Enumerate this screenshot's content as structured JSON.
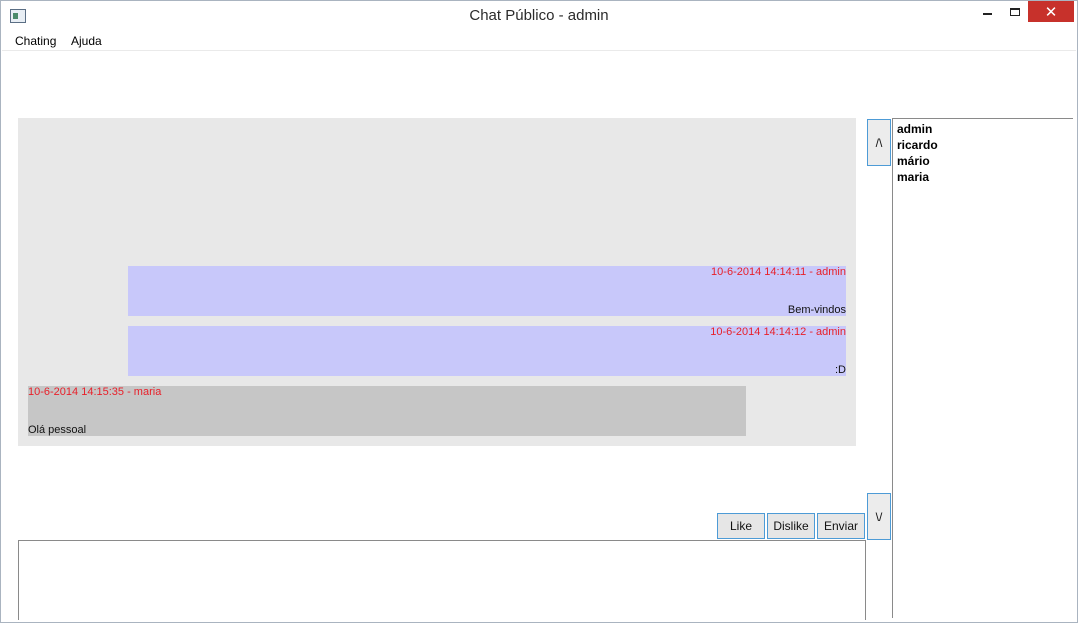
{
  "window": {
    "title": "Chat Público - admin",
    "app_icon": "window-app-icon",
    "controls": {
      "minimize": "minimize-icon",
      "maximize": "maximize-icon",
      "close": "✕"
    }
  },
  "menu": {
    "items": [
      "Chating",
      "Ajuda"
    ]
  },
  "messages": [
    {
      "meta": "10-6-2014 14:14:11 - admin",
      "text": "Bem-vindos",
      "align": "right"
    },
    {
      "meta": "10-6-2014 14:14:12 - admin",
      "text": ":D",
      "align": "right"
    },
    {
      "meta": "10-6-2014 14:15:35 - maria",
      "text": "Olá pessoal",
      "align": "left"
    }
  ],
  "scroll": {
    "up_label": "/\\",
    "down_label": "\\/"
  },
  "users": [
    "admin",
    "ricardo",
    "mário",
    "maria"
  ],
  "actions": {
    "like_label": "Like",
    "dislike_label": "Dislike",
    "send_label": "Enviar"
  },
  "compose": {
    "value": ""
  },
  "colors": {
    "self_bubble": "#c8c8fa",
    "other_bubble": "#c6c6c6",
    "meta_text": "#e8202a",
    "chat_background": "#e8e8e8",
    "close_button": "#c7312b"
  }
}
